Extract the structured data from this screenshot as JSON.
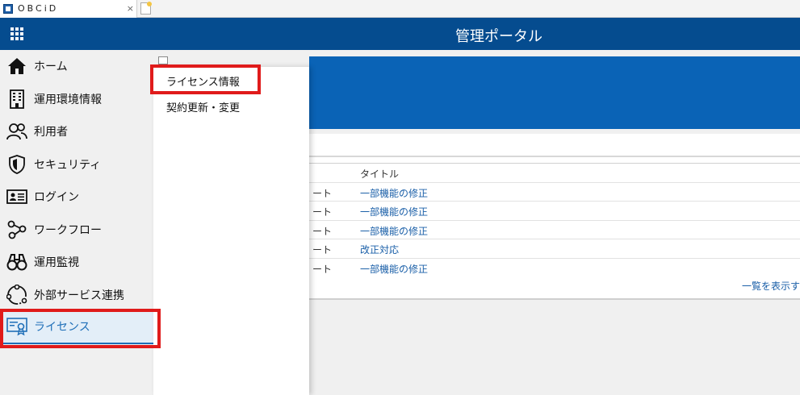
{
  "browser": {
    "tab_title": "OBCiD",
    "tab_close": "×"
  },
  "header": {
    "title": "管理ポータル"
  },
  "sidebar": {
    "items": [
      {
        "label": "ホーム",
        "icon": "home-icon"
      },
      {
        "label": "運用環境情報",
        "icon": "building-icon"
      },
      {
        "label": "利用者",
        "icon": "users-icon"
      },
      {
        "label": "セキュリティ",
        "icon": "shield-icon"
      },
      {
        "label": "ログイン",
        "icon": "id-card-icon"
      },
      {
        "label": "ワークフロー",
        "icon": "workflow-icon"
      },
      {
        "label": "運用監視",
        "icon": "binoculars-icon"
      },
      {
        "label": "外部サービス連携",
        "icon": "link-icon"
      },
      {
        "label": "ライセンス",
        "icon": "certificate-icon"
      }
    ]
  },
  "submenu": {
    "items": [
      {
        "label": "ライセンス情報"
      },
      {
        "label": "契約更新・変更"
      }
    ]
  },
  "news": {
    "header_title": "タイトル",
    "rows": [
      {
        "type": "ート",
        "title": "一部機能の修正"
      },
      {
        "type": "ート",
        "title": "一部機能の修正"
      },
      {
        "type": "ート",
        "title": "一部機能の修正"
      },
      {
        "type": "ート",
        "title": "改正対応"
      },
      {
        "type": "ート",
        "title": "一部機能の修正"
      }
    ],
    "show_all": "一覧を表示す"
  },
  "colors": {
    "header": "#054c8f",
    "banner": "#0a63b6",
    "highlight": "#e01b1b",
    "link": "#1a5fa8"
  }
}
